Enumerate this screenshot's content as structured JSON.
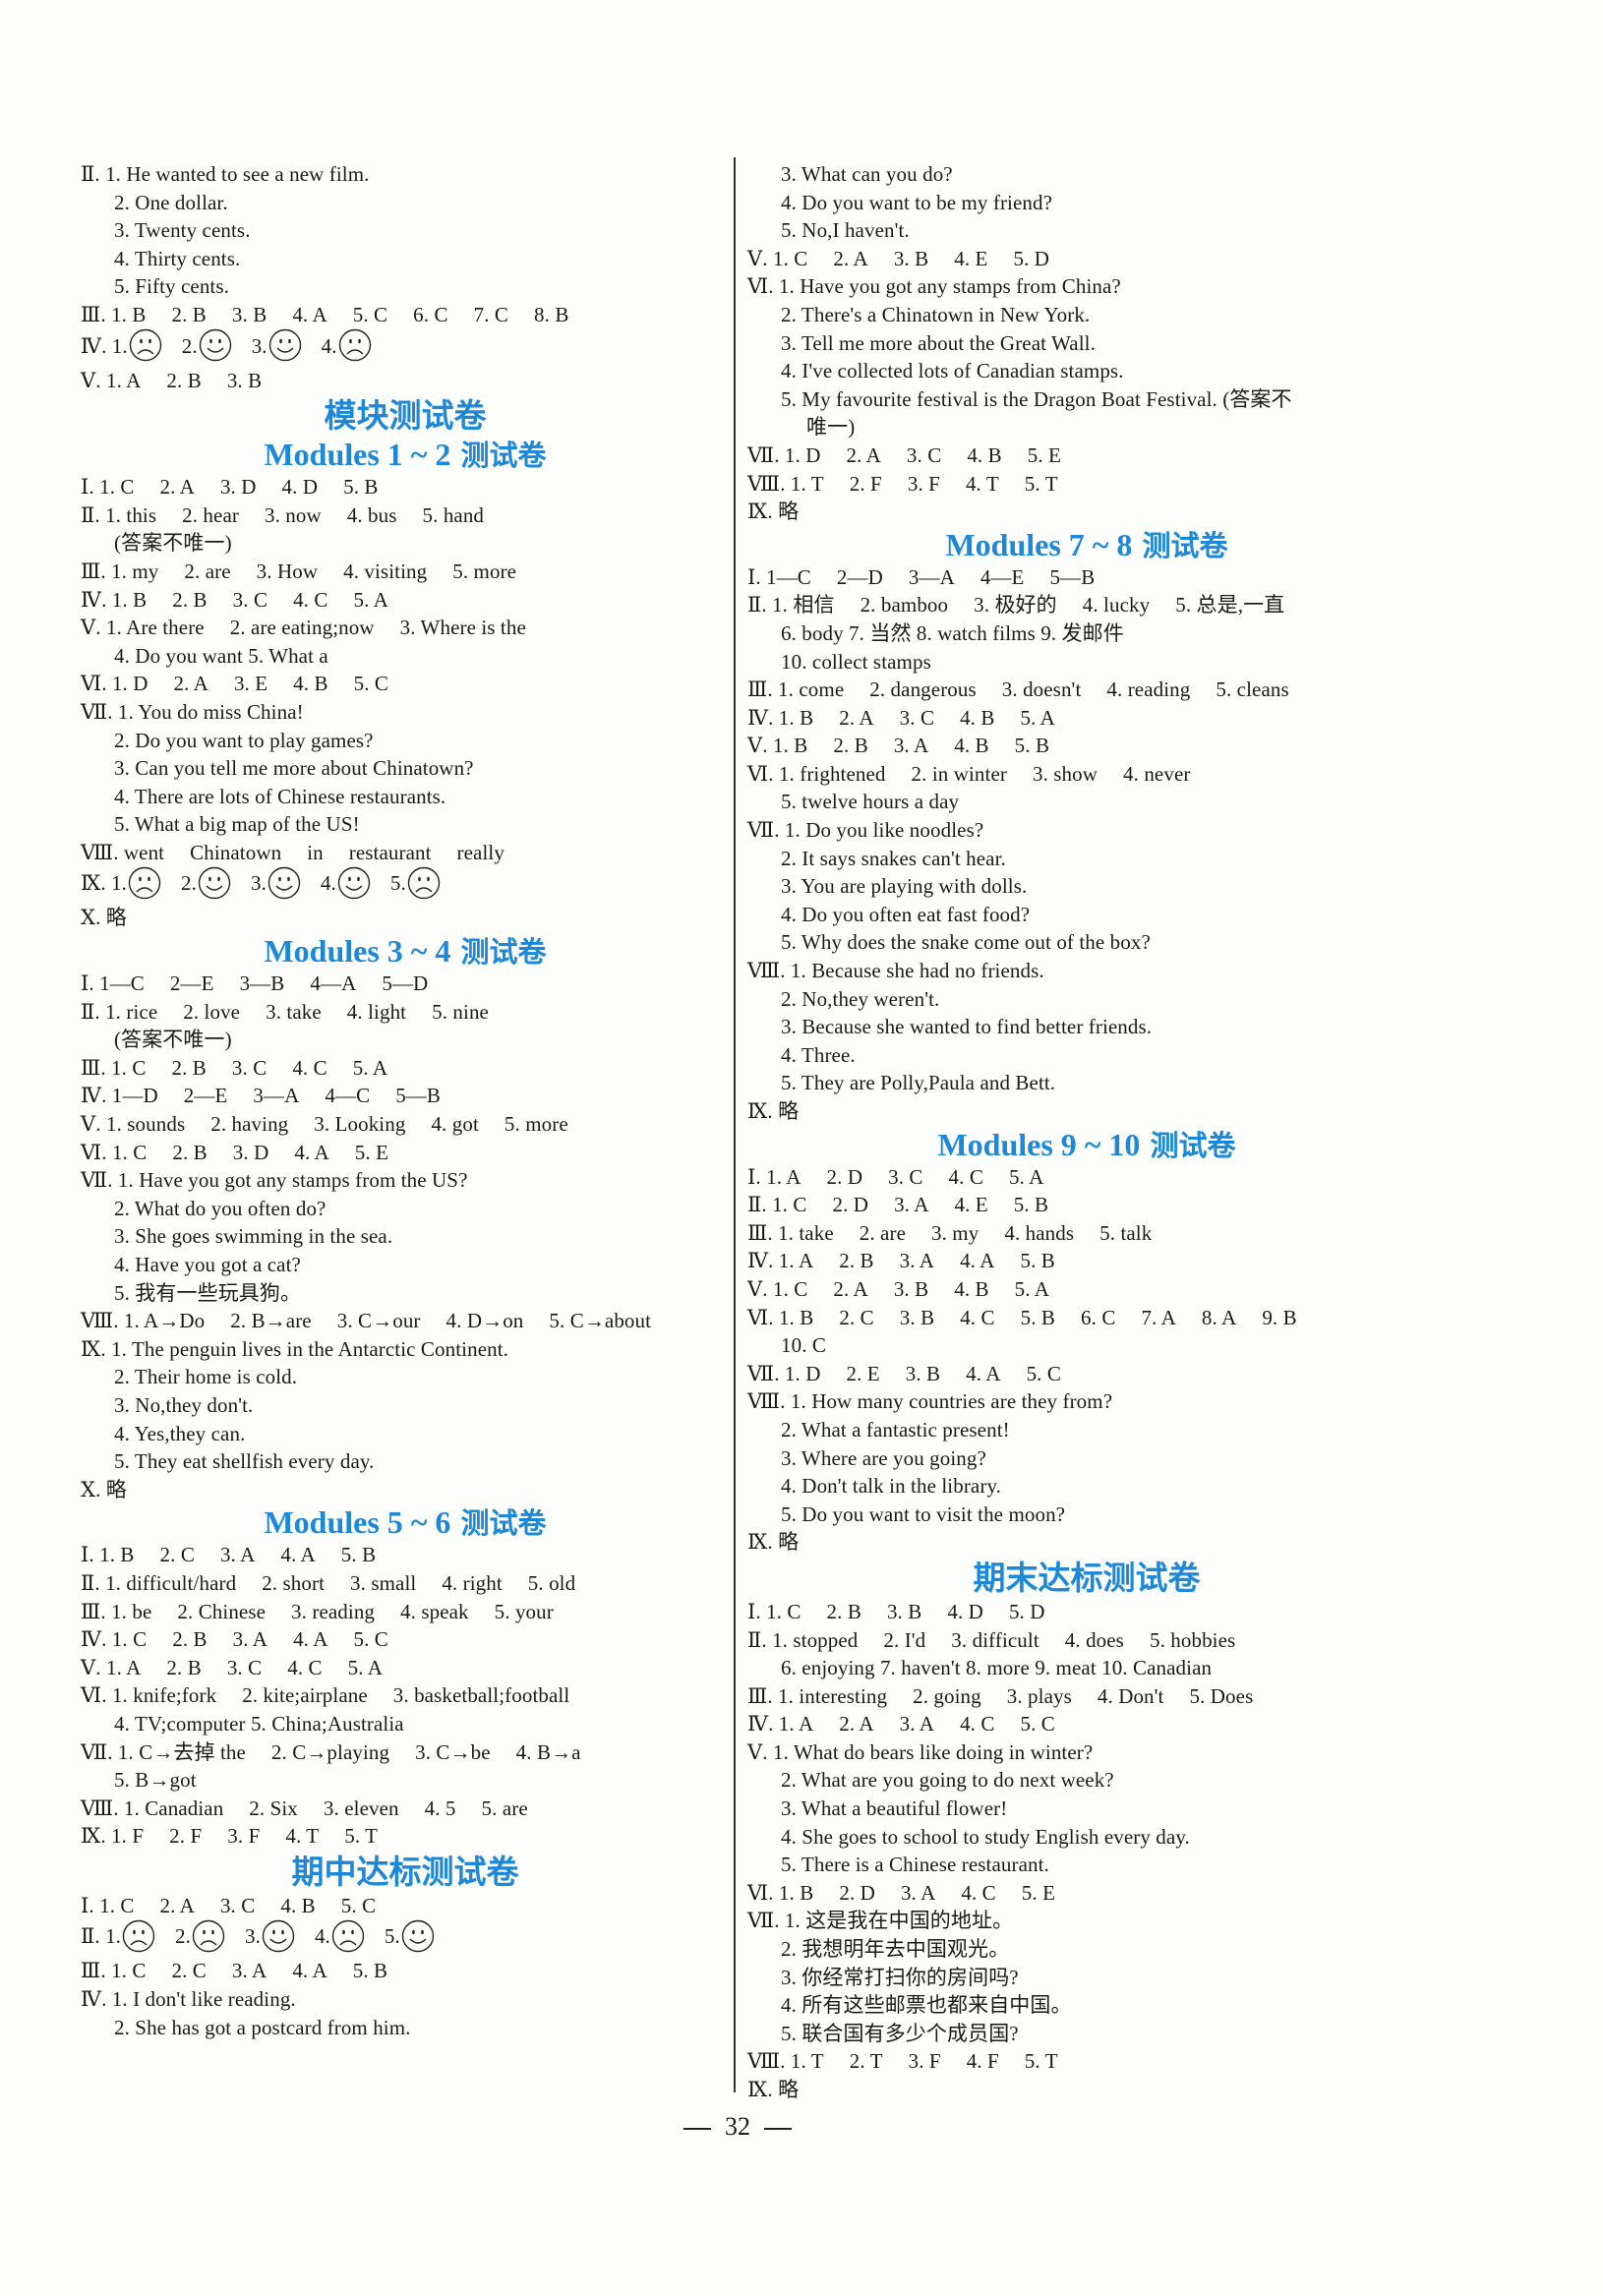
{
  "page_number": "32",
  "left_column": [
    {
      "type": "line",
      "rn": "Ⅱ",
      "text": "1. He wanted to see a new film."
    },
    {
      "type": "sub",
      "text": "2. One dollar."
    },
    {
      "type": "sub",
      "text": "3. Twenty cents."
    },
    {
      "type": "sub",
      "text": "4. Thirty cents."
    },
    {
      "type": "sub",
      "text": "5. Fifty cents."
    },
    {
      "type": "answers",
      "rn": "Ⅲ",
      "items": [
        "1. B",
        "2. B",
        "3. B",
        "4. A",
        "5. C",
        "6. C",
        "7. C",
        "8. B"
      ]
    },
    {
      "type": "faces",
      "rn": "Ⅳ",
      "items": [
        {
          "n": "1.",
          "face": "sad"
        },
        {
          "n": "2.",
          "face": "happy"
        },
        {
          "n": "3.",
          "face": "happy"
        },
        {
          "n": "4.",
          "face": "sad"
        }
      ]
    },
    {
      "type": "answers",
      "rn": "Ⅴ",
      "items": [
        "1. A",
        "2. B",
        "3. B"
      ]
    },
    {
      "type": "heading-main",
      "text": "模块测试卷"
    },
    {
      "type": "heading-sub",
      "en": "Modules 1 ~ 2",
      "zh": "测试卷"
    },
    {
      "type": "answers",
      "rn": "Ⅰ",
      "items": [
        "1. C",
        "2. A",
        "3. D",
        "4. D",
        "5. B"
      ]
    },
    {
      "type": "answers",
      "rn": "Ⅱ",
      "items": [
        "1. this",
        "2. hear",
        "3. now",
        "4. bus",
        "5. hand"
      ]
    },
    {
      "type": "sub",
      "text": "(答案不唯一)"
    },
    {
      "type": "answers",
      "rn": "Ⅲ",
      "items": [
        "1. my",
        "2. are",
        "3. How",
        "4. visiting",
        "5. more"
      ]
    },
    {
      "type": "answers",
      "rn": "Ⅳ",
      "items": [
        "1. B",
        "2. B",
        "3. C",
        "4. C",
        "5. A"
      ]
    },
    {
      "type": "answers",
      "rn": "Ⅴ",
      "items": [
        "1. Are there",
        "2. are eating;now",
        "3. Where is the"
      ]
    },
    {
      "type": "sub",
      "text": "4. Do you want    5. What a"
    },
    {
      "type": "answers",
      "rn": "Ⅵ",
      "items": [
        "1. D",
        "2. A",
        "3. E",
        "4. B",
        "5. C"
      ]
    },
    {
      "type": "line",
      "rn": "Ⅶ",
      "text": "1. You do miss China!"
    },
    {
      "type": "sub",
      "text": "2. Do you want to play games?"
    },
    {
      "type": "sub",
      "text": "3. Can you tell me more about Chinatown?"
    },
    {
      "type": "sub",
      "text": "4. There are lots of Chinese restaurants."
    },
    {
      "type": "sub",
      "text": "5. What a big map of the US!"
    },
    {
      "type": "answers",
      "rn": "Ⅷ",
      "items": [
        "went",
        "Chinatown",
        "in",
        "restaurant",
        "really"
      ]
    },
    {
      "type": "faces",
      "rn": "Ⅸ",
      "items": [
        {
          "n": "1.",
          "face": "sad"
        },
        {
          "n": "2.",
          "face": "happy"
        },
        {
          "n": "3.",
          "face": "happy"
        },
        {
          "n": "4.",
          "face": "happy"
        },
        {
          "n": "5.",
          "face": "sad"
        }
      ]
    },
    {
      "type": "line",
      "rn": "Ⅹ",
      "text": "略"
    },
    {
      "type": "heading-sub",
      "en": "Modules 3 ~ 4",
      "zh": "测试卷"
    },
    {
      "type": "answers",
      "rn": "Ⅰ",
      "items": [
        "1—C",
        "2—E",
        "3—B",
        "4—A",
        "5—D"
      ]
    },
    {
      "type": "answers",
      "rn": "Ⅱ",
      "items": [
        "1. rice",
        "2. love",
        "3. take",
        "4. light",
        "5. nine"
      ]
    },
    {
      "type": "sub",
      "text": "(答案不唯一)"
    },
    {
      "type": "answers",
      "rn": "Ⅲ",
      "items": [
        "1. C",
        "2. B",
        "3. C",
        "4. C",
        "5. A"
      ]
    },
    {
      "type": "answers",
      "rn": "Ⅳ",
      "items": [
        "1—D",
        "2—E",
        "3—A",
        "4—C",
        "5—B"
      ]
    },
    {
      "type": "answers",
      "rn": "Ⅴ",
      "items": [
        "1. sounds",
        "2. having",
        "3. Looking",
        "4. got",
        "5. more"
      ]
    },
    {
      "type": "answers",
      "rn": "Ⅵ",
      "items": [
        "1. C",
        "2. B",
        "3. D",
        "4. A",
        "5. E"
      ]
    },
    {
      "type": "line",
      "rn": "Ⅶ",
      "text": "1. Have you got any stamps from the US?"
    },
    {
      "type": "sub",
      "text": "2. What do you often do?"
    },
    {
      "type": "sub",
      "text": "3. She goes swimming in the sea."
    },
    {
      "type": "sub",
      "text": "4. Have you got a cat?"
    },
    {
      "type": "sub",
      "text": "5. 我有一些玩具狗。"
    },
    {
      "type": "answers",
      "rn": "Ⅷ",
      "items": [
        "1. A→Do",
        "2. B→are",
        "3. C→our",
        "4. D→on",
        "5. C→about"
      ]
    },
    {
      "type": "line",
      "rn": "Ⅸ",
      "text": "1. The penguin lives in the Antarctic Continent."
    },
    {
      "type": "sub",
      "text": "2. Their home is cold."
    },
    {
      "type": "sub",
      "text": "3. No,they don't."
    },
    {
      "type": "sub",
      "text": "4. Yes,they can."
    },
    {
      "type": "sub",
      "text": "5. They eat shellfish every day."
    },
    {
      "type": "line",
      "rn": "Ⅹ",
      "text": "略"
    },
    {
      "type": "heading-sub",
      "en": "Modules 5 ~ 6",
      "zh": "测试卷"
    },
    {
      "type": "answers",
      "rn": "Ⅰ",
      "items": [
        "1. B",
        "2. C",
        "3. A",
        "4. A",
        "5. B"
      ]
    },
    {
      "type": "answers",
      "rn": "Ⅱ",
      "items": [
        "1. difficult/hard",
        "2. short",
        "3. small",
        "4. right",
        "5. old"
      ]
    },
    {
      "type": "answers",
      "rn": "Ⅲ",
      "items": [
        "1. be",
        "2. Chinese",
        "3. reading",
        "4. speak",
        "5. your"
      ]
    },
    {
      "type": "answers",
      "rn": "Ⅳ",
      "items": [
        "1. C",
        "2. B",
        "3. A",
        "4. A",
        "5. C"
      ]
    },
    {
      "type": "answers",
      "rn": "Ⅴ",
      "items": [
        "1. A",
        "2. B",
        "3. C",
        "4. C",
        "5. A"
      ]
    },
    {
      "type": "answers",
      "rn": "Ⅵ",
      "items": [
        "1. knife;fork",
        "2. kite;airplane",
        "3. basketball;football"
      ]
    },
    {
      "type": "sub",
      "text": "4. TV;computer    5. China;Australia"
    },
    {
      "type": "answers",
      "rn": "Ⅶ",
      "items": [
        "1. C→去掉 the",
        "2. C→playing",
        "3. C→be",
        "4. B→a"
      ]
    },
    {
      "type": "sub",
      "text": "5. B→got"
    },
    {
      "type": "answers",
      "rn": "Ⅷ",
      "items": [
        "1. Canadian",
        "2. Six",
        "3. eleven",
        "4. 5",
        "5. are"
      ]
    },
    {
      "type": "answers",
      "rn": "Ⅸ",
      "items": [
        "1. F",
        "2. F",
        "3. F",
        "4. T",
        "5. T"
      ]
    },
    {
      "type": "heading-main",
      "text": "期中达标测试卷"
    },
    {
      "type": "answers",
      "rn": "Ⅰ",
      "items": [
        "1. C",
        "2. A",
        "3. C",
        "4. B",
        "5. C"
      ]
    },
    {
      "type": "faces",
      "rn": "Ⅱ",
      "items": [
        {
          "n": "1.",
          "face": "sad"
        },
        {
          "n": "2.",
          "face": "sad"
        },
        {
          "n": "3.",
          "face": "happy"
        },
        {
          "n": "4.",
          "face": "sad"
        },
        {
          "n": "5.",
          "face": "happy"
        }
      ]
    },
    {
      "type": "answers",
      "rn": "Ⅲ",
      "items": [
        "1. C",
        "2. C",
        "3. A",
        "4. A",
        "5. B"
      ]
    },
    {
      "type": "line",
      "rn": "Ⅳ",
      "text": "1. I don't like reading."
    },
    {
      "type": "sub",
      "text": "2. She has got a postcard from him."
    }
  ],
  "right_column": [
    {
      "type": "sub",
      "text": "3. What can you do?"
    },
    {
      "type": "sub",
      "text": "4. Do you want to be my friend?"
    },
    {
      "type": "sub",
      "text": "5. No,I haven't."
    },
    {
      "type": "answers",
      "rn": "Ⅴ",
      "items": [
        "1. C",
        "2. A",
        "3. B",
        "4. E",
        "5. D"
      ]
    },
    {
      "type": "line",
      "rn": "Ⅵ",
      "text": "1. Have you got any stamps from China?"
    },
    {
      "type": "sub",
      "text": "2. There's a Chinatown in New York."
    },
    {
      "type": "sub",
      "text": "3. Tell me more about the Great Wall."
    },
    {
      "type": "sub",
      "text": "4. I've collected lots of Canadian stamps."
    },
    {
      "type": "sub",
      "text": "5. My favourite festival is the Dragon Boat Festival. (答案不"
    },
    {
      "type": "sub2",
      "text": "唯一)"
    },
    {
      "type": "answers",
      "rn": "Ⅶ",
      "items": [
        "1. D",
        "2. A",
        "3. C",
        "4. B",
        "5. E"
      ]
    },
    {
      "type": "answers",
      "rn": "Ⅷ",
      "items": [
        "1. T",
        "2. F",
        "3. F",
        "4. T",
        "5. T"
      ]
    },
    {
      "type": "line",
      "rn": "Ⅸ",
      "text": "略"
    },
    {
      "type": "heading-sub",
      "en": "Modules 7 ~ 8",
      "zh": "测试卷"
    },
    {
      "type": "answers",
      "rn": "Ⅰ",
      "items": [
        "1—C",
        "2—D",
        "3—A",
        "4—E",
        "5—B"
      ]
    },
    {
      "type": "answers",
      "rn": "Ⅱ",
      "items": [
        "1. 相信",
        "2. bamboo",
        "3. 极好的",
        "4. lucky",
        "5. 总是,一直"
      ]
    },
    {
      "type": "sub",
      "text": "6. body    7. 当然    8. watch films    9. 发邮件"
    },
    {
      "type": "sub",
      "text": "10. collect stamps"
    },
    {
      "type": "answers",
      "rn": "Ⅲ",
      "items": [
        "1. come",
        "2. dangerous",
        "3. doesn't",
        "4. reading",
        "5. cleans"
      ]
    },
    {
      "type": "answers",
      "rn": "Ⅳ",
      "items": [
        "1. B",
        "2. A",
        "3. C",
        "4. B",
        "5. A"
      ]
    },
    {
      "type": "answers",
      "rn": "Ⅴ",
      "items": [
        "1. B",
        "2. B",
        "3. A",
        "4. B",
        "5. B"
      ]
    },
    {
      "type": "answers",
      "rn": "Ⅵ",
      "items": [
        "1. frightened",
        "2. in winter",
        "3. show",
        "4. never"
      ]
    },
    {
      "type": "sub",
      "text": "5. twelve hours a day"
    },
    {
      "type": "line",
      "rn": "Ⅶ",
      "text": "1. Do you like noodles?"
    },
    {
      "type": "sub",
      "text": "2. It says snakes can't hear."
    },
    {
      "type": "sub",
      "text": "3. You are playing with dolls."
    },
    {
      "type": "sub",
      "text": "4. Do you often eat fast food?"
    },
    {
      "type": "sub",
      "text": "5. Why does the snake come out of the box?"
    },
    {
      "type": "line",
      "rn": "Ⅷ",
      "text": "1. Because she had no friends."
    },
    {
      "type": "sub",
      "text": "2. No,they weren't."
    },
    {
      "type": "sub",
      "text": "3. Because she wanted to find better friends."
    },
    {
      "type": "sub",
      "text": "4. Three."
    },
    {
      "type": "sub",
      "text": "5. They are Polly,Paula and Bett."
    },
    {
      "type": "line",
      "rn": "Ⅸ",
      "text": "略"
    },
    {
      "type": "heading-sub",
      "en": "Modules 9 ~ 10",
      "zh": "测试卷"
    },
    {
      "type": "answers",
      "rn": "Ⅰ",
      "items": [
        "1. A",
        "2. D",
        "3. C",
        "4. C",
        "5. A"
      ]
    },
    {
      "type": "answers",
      "rn": "Ⅱ",
      "items": [
        "1. C",
        "2. D",
        "3. A",
        "4. E",
        "5. B"
      ]
    },
    {
      "type": "answers",
      "rn": "Ⅲ",
      "items": [
        "1. take",
        "2. are",
        "3. my",
        "4. hands",
        "5. talk"
      ]
    },
    {
      "type": "answers",
      "rn": "Ⅳ",
      "items": [
        "1. A",
        "2. B",
        "3. A",
        "4. A",
        "5. B"
      ]
    },
    {
      "type": "answers",
      "rn": "Ⅴ",
      "items": [
        "1. C",
        "2. A",
        "3. B",
        "4. B",
        "5. A"
      ]
    },
    {
      "type": "answers",
      "rn": "Ⅵ",
      "items": [
        "1. B",
        "2. C",
        "3. B",
        "4. C",
        "5. B",
        "6. C",
        "7. A",
        "8. A",
        "9. B"
      ]
    },
    {
      "type": "sub",
      "text": "10. C"
    },
    {
      "type": "answers",
      "rn": "Ⅶ",
      "items": [
        "1. D",
        "2. E",
        "3. B",
        "4. A",
        "5. C"
      ]
    },
    {
      "type": "line",
      "rn": "Ⅷ",
      "text": "1. How many countries are they from?"
    },
    {
      "type": "sub",
      "text": "2. What a fantastic present!"
    },
    {
      "type": "sub",
      "text": "3. Where are you going?"
    },
    {
      "type": "sub",
      "text": "4. Don't talk in the library."
    },
    {
      "type": "sub",
      "text": "5. Do you want to visit the moon?"
    },
    {
      "type": "line",
      "rn": "Ⅸ",
      "text": "略"
    },
    {
      "type": "heading-main",
      "text": "期末达标测试卷"
    },
    {
      "type": "answers",
      "rn": "Ⅰ",
      "items": [
        "1. C",
        "2. B",
        "3. B",
        "4. D",
        "5. D"
      ]
    },
    {
      "type": "answers",
      "rn": "Ⅱ",
      "items": [
        "1. stopped",
        "2. I'd",
        "3. difficult",
        "4. does",
        "5. hobbies"
      ]
    },
    {
      "type": "sub",
      "text": "6. enjoying    7. haven't    8. more    9. meat    10. Canadian"
    },
    {
      "type": "answers",
      "rn": "Ⅲ",
      "items": [
        "1. interesting",
        "2. going",
        "3. plays",
        "4. Don't",
        "5. Does"
      ]
    },
    {
      "type": "answers",
      "rn": "Ⅳ",
      "items": [
        "1. A",
        "2. A",
        "3. A",
        "4. C",
        "5. C"
      ]
    },
    {
      "type": "line",
      "rn": "Ⅴ",
      "text": "1. What do bears like doing in winter?"
    },
    {
      "type": "sub",
      "text": "2. What are you going to do next week?"
    },
    {
      "type": "sub",
      "text": "3. What a beautiful flower!"
    },
    {
      "type": "sub",
      "text": "4. She goes to school to study English every day."
    },
    {
      "type": "sub",
      "text": "5. There is a Chinese restaurant."
    },
    {
      "type": "answers",
      "rn": "Ⅵ",
      "items": [
        "1. B",
        "2. D",
        "3. A",
        "4. C",
        "5. E"
      ]
    },
    {
      "type": "line",
      "rn": "Ⅶ",
      "text": "1. 这是我在中国的地址。"
    },
    {
      "type": "sub",
      "text": "2. 我想明年去中国观光。"
    },
    {
      "type": "sub",
      "text": "3. 你经常打扫你的房间吗?"
    },
    {
      "type": "sub",
      "text": "4. 所有这些邮票也都来自中国。"
    },
    {
      "type": "sub",
      "text": "5. 联合国有多少个成员国?"
    },
    {
      "type": "answers",
      "rn": "Ⅷ",
      "items": [
        "1. T",
        "2. T",
        "3. F",
        "4. F",
        "5. T"
      ]
    },
    {
      "type": "line",
      "rn": "Ⅸ",
      "text": "略"
    }
  ]
}
